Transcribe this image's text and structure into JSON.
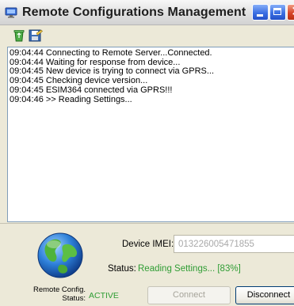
{
  "window": {
    "title": "Remote Configurations Management"
  },
  "toolbar": {
    "items": [
      {
        "icon": "recycle-bin-icon"
      },
      {
        "icon": "save-icon"
      }
    ]
  },
  "log": {
    "lines": [
      "09:04:44 Connecting to Remote Server...Connected.",
      "09:04:44 Waiting for response from device...",
      "09:04:45 New device is trying to connect via GPRS...",
      "09:04:45 Checking device version...",
      "09:04:45 ESIM364 connected via GPRS!!!",
      "09:04:46  >> Reading Settings..."
    ]
  },
  "device": {
    "imei_label": "Device IMEI:",
    "imei_value": "013226005471855",
    "status_label": "Status:",
    "status_value": "Reading Settings... [83%]",
    "progress_percent": 83
  },
  "remote_config": {
    "label_line1": "Remote Config.",
    "label_line2": "Status:",
    "value": "ACTIVE"
  },
  "buttons": {
    "connect": "Connect",
    "disconnect": "Disconnect"
  },
  "colors": {
    "status_green": "#2f9d34",
    "log_border": "#7f9db9",
    "window_bg": "#ece9d8"
  }
}
